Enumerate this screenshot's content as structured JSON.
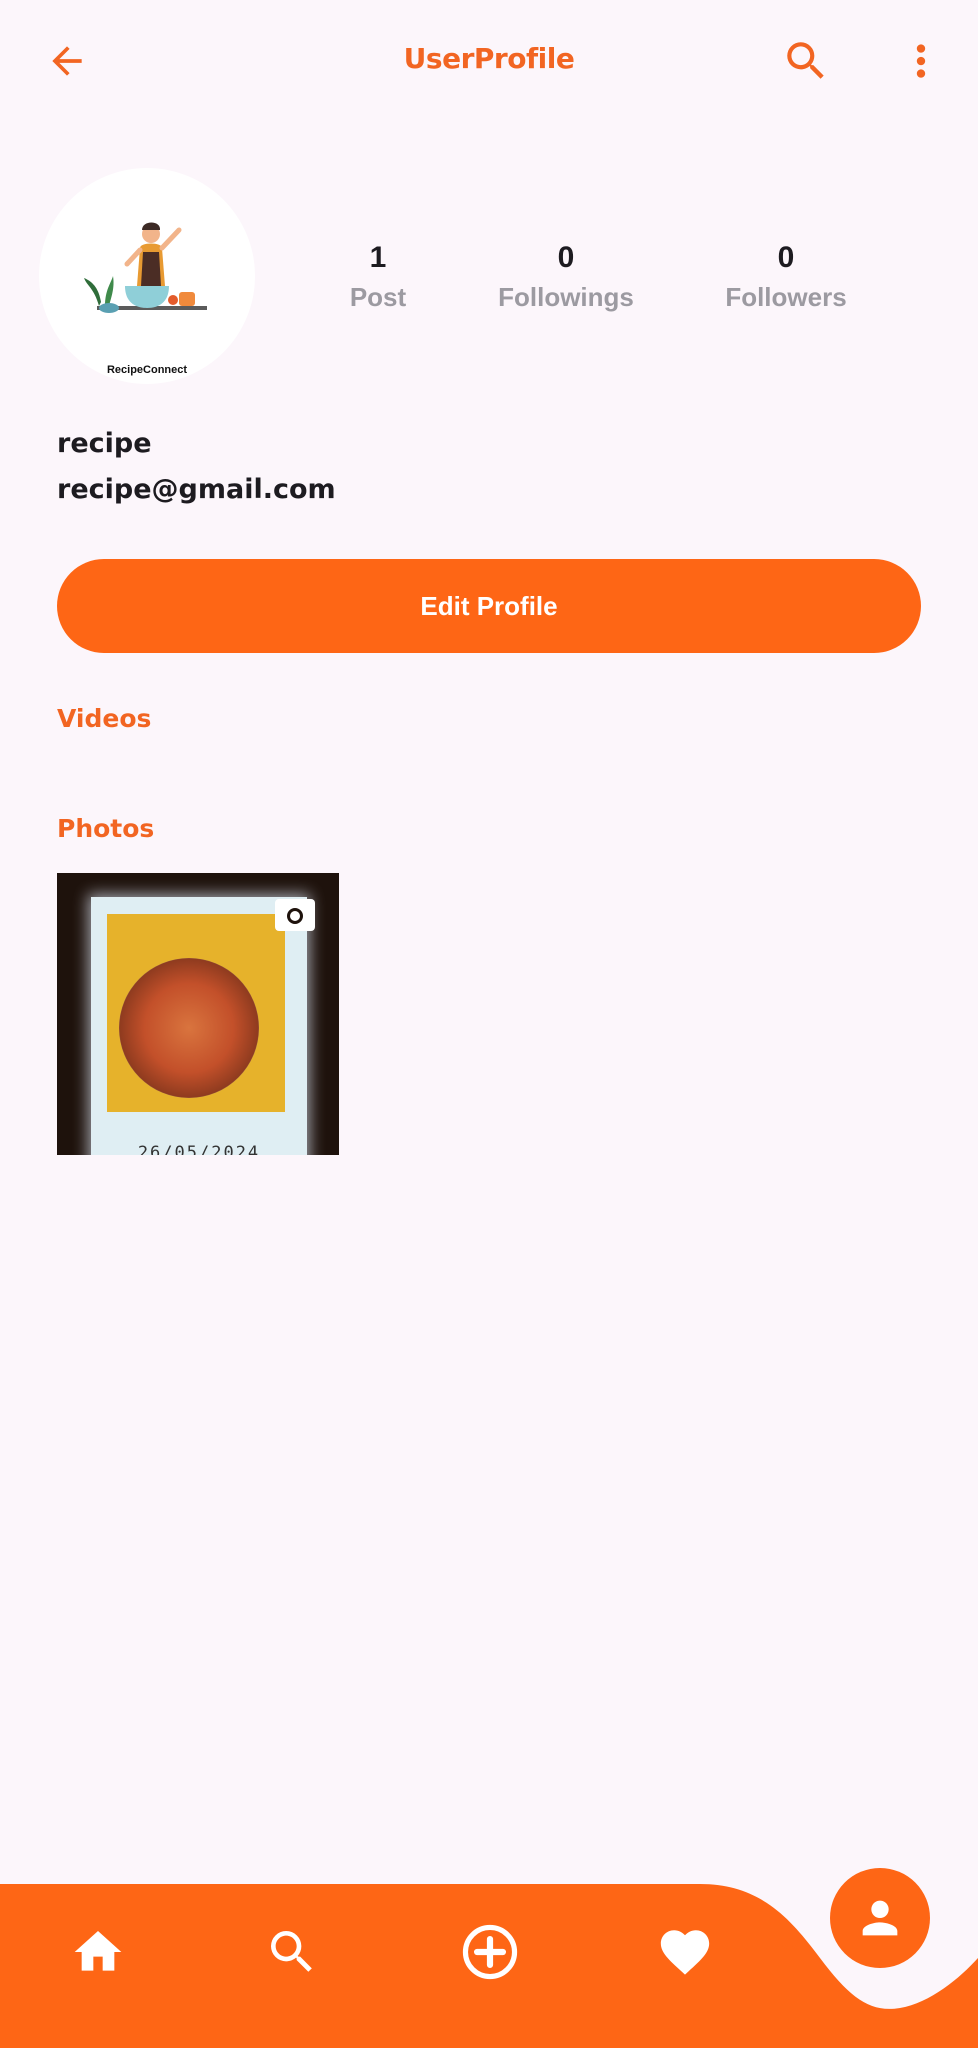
{
  "appbar": {
    "title": "UserProfile",
    "back_icon": "arrow-back-icon",
    "search_icon": "search-icon",
    "more_icon": "more-vert-icon"
  },
  "profile": {
    "avatar_caption": "RecipeConnect",
    "username": "recipe",
    "email": "recipe@gmail.com",
    "stats": [
      {
        "value": "1",
        "label": "Post"
      },
      {
        "value": "0",
        "label": "Followings"
      },
      {
        "value": "0",
        "label": "Followers"
      }
    ],
    "edit_button_label": "Edit Profile"
  },
  "sections": {
    "videos_title": "Videos",
    "photos_title": "Photos"
  },
  "photos": [
    {
      "date": "26/05/2024"
    }
  ],
  "bottom_nav": {
    "items": [
      "home-icon",
      "search-icon",
      "add-circle-icon",
      "heart-icon",
      "person-icon"
    ],
    "active": "person-icon"
  },
  "colors": {
    "accent": "#fe6615",
    "title": "#f26522",
    "background": "#fcf6fb",
    "muted_text": "#9c9aa1"
  }
}
